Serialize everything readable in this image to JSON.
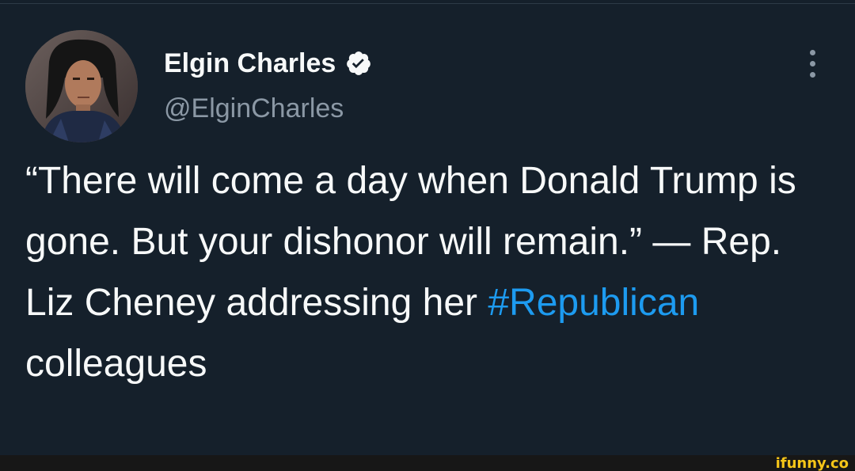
{
  "tweet": {
    "author": {
      "display_name": "Elgin Charles",
      "handle": "@ElginCharles",
      "verified": true
    },
    "text_part1": "“There will come a day when Donald Trump is gone. But your dishonor will remain.” — Rep. Liz Cheney addressing her ",
    "hashtag": "#Republican",
    "text_part2": " colleagues"
  },
  "icons": {
    "verified": "verified-badge-icon",
    "more": "more-options-icon"
  },
  "colors": {
    "background": "#15202b",
    "text": "#f7f9f9",
    "secondary_text": "#8b98a5",
    "hashtag": "#1d9bf0",
    "watermark": "#f5c518"
  },
  "watermark": {
    "text": "ifunny.co"
  }
}
